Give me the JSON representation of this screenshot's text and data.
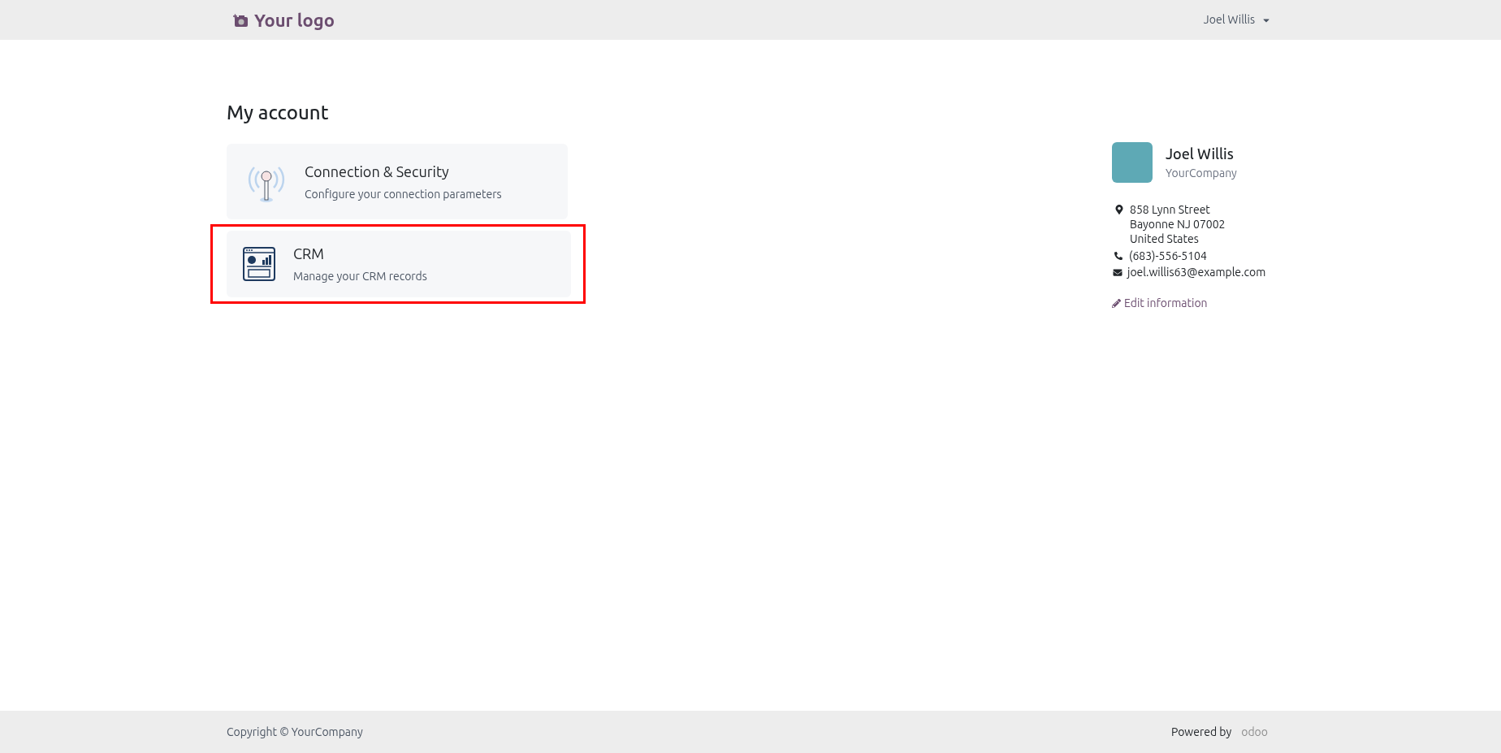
{
  "header": {
    "logo_text": "Your logo",
    "user_menu": "Joel Willis"
  },
  "page_title": "My account",
  "cards": [
    {
      "kind": "connection",
      "title": "Connection & Security",
      "subtitle": "Configure your connection parameters",
      "highlighted": false
    },
    {
      "kind": "crm",
      "title": "CRM",
      "subtitle": "Manage your CRM records",
      "highlighted": true
    }
  ],
  "profile": {
    "name": "Joel Willis",
    "company": "YourCompany",
    "address": [
      "858 Lynn Street",
      "Bayonne NJ 07002",
      "United States"
    ],
    "phone": "(683)-556-5104",
    "email": "joel.willis63@example.com",
    "edit_link": "Edit information"
  },
  "footer": {
    "copyright": "Copyright © YourCompany",
    "powered_by": "Powered by",
    "brand": "odoo"
  }
}
